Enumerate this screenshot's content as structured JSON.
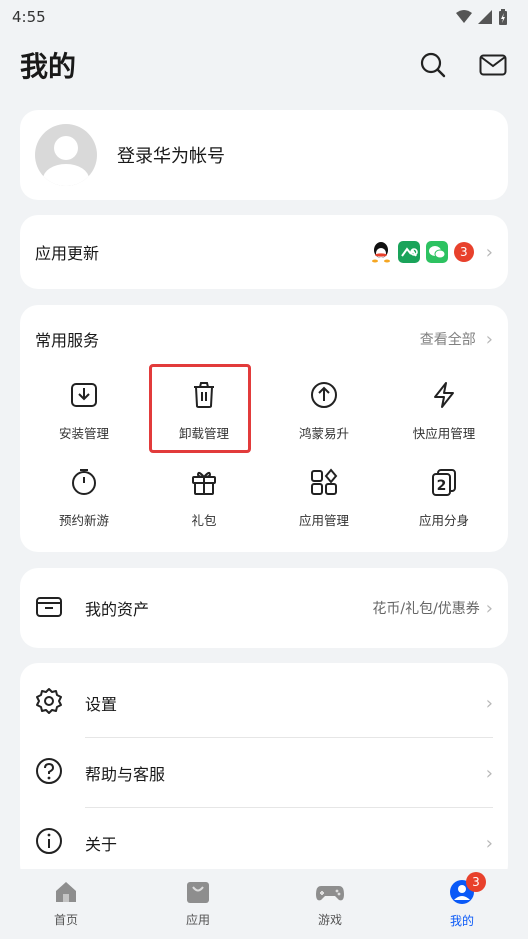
{
  "status_bar": {
    "time": "4:55"
  },
  "header": {
    "title": "我的"
  },
  "login": {
    "text": "登录华为帐号"
  },
  "updates": {
    "label": "应用更新",
    "badge_count": "3"
  },
  "services": {
    "title": "常用服务",
    "view_all": "查看全部",
    "items": [
      {
        "label": "安装管理",
        "icon": "install-icon"
      },
      {
        "label": "卸载管理",
        "icon": "trash-icon"
      },
      {
        "label": "鸿蒙易升",
        "icon": "upgrade-icon"
      },
      {
        "label": "快应用管理",
        "icon": "quick-app-icon"
      },
      {
        "label": "预约新游",
        "icon": "stopwatch-icon"
      },
      {
        "label": "礼包",
        "icon": "gift-icon"
      },
      {
        "label": "应用管理",
        "icon": "apps-grid-icon"
      },
      {
        "label": "应用分身",
        "icon": "app-twin-icon"
      }
    ]
  },
  "assets": {
    "label": "我的资产",
    "detail": "花币/礼包/优惠券"
  },
  "settings_list": {
    "items": [
      {
        "label": "设置",
        "icon": "gear-icon"
      },
      {
        "label": "帮助与客服",
        "icon": "help-icon"
      },
      {
        "label": "关于",
        "icon": "info-icon"
      }
    ]
  },
  "bottom_nav": {
    "items": [
      {
        "label": "首页",
        "icon": "home-icon"
      },
      {
        "label": "应用",
        "icon": "app-bag-icon"
      },
      {
        "label": "游戏",
        "icon": "gamepad-icon"
      },
      {
        "label": "我的",
        "icon": "profile-icon"
      }
    ],
    "active": "我的",
    "profile_badge": "3"
  },
  "colors": {
    "accent": "#0a59f7",
    "badge": "#e8412c",
    "highlight": "#e23b3b"
  }
}
